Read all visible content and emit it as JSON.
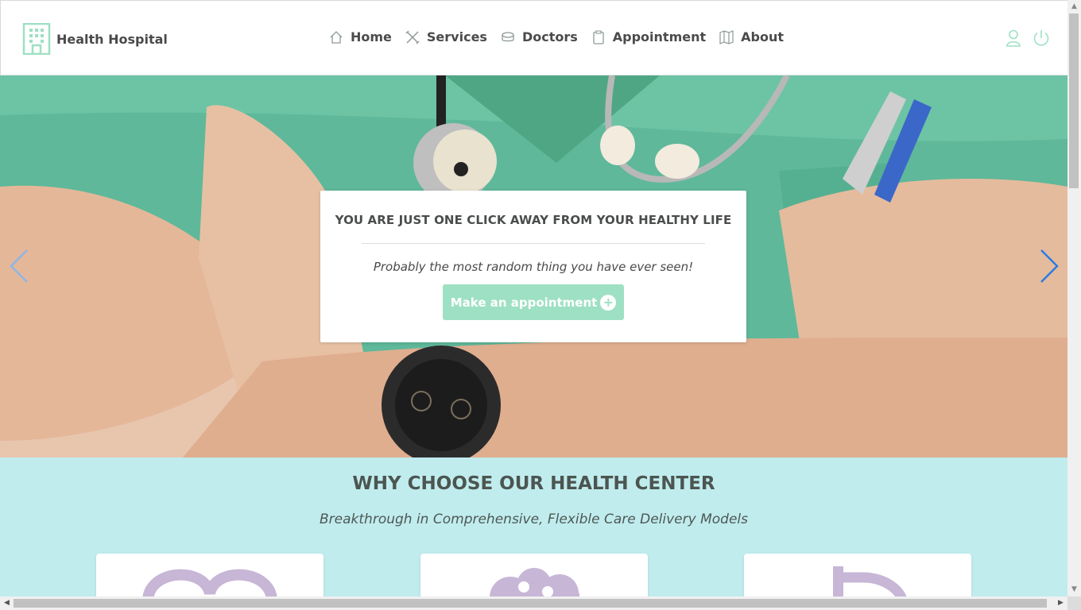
{
  "brand": {
    "name": "Health Hospital"
  },
  "nav": {
    "items": [
      {
        "label": "Home",
        "icon": "home-icon"
      },
      {
        "label": "Services",
        "icon": "tools-icon"
      },
      {
        "label": "Doctors",
        "icon": "doctors-icon"
      },
      {
        "label": "Appointment",
        "icon": "clipboard-icon"
      },
      {
        "label": "About",
        "icon": "map-icon"
      }
    ],
    "right_icons": [
      "user-icon",
      "power-icon"
    ]
  },
  "hero": {
    "title": "YOU ARE JUST ONE CLICK AWAY FROM YOUR HEALTHY LIFE",
    "subtitle": "Probably the most random thing you have ever seen!",
    "button_label": "Make an appointment",
    "button_icon": "plus-circle-icon",
    "prev_icon": "chevron-left-icon",
    "next_icon": "chevron-right-icon"
  },
  "why": {
    "title": "WHY CHOOSE OUR HEALTH CENTER",
    "subtitle": "Breakthrough in Comprehensive, Flexible Care Delivery Models",
    "cards": [
      {
        "icon": "infinity-icon"
      },
      {
        "icon": "cloud-icon"
      },
      {
        "icon": "dollar-icon"
      }
    ]
  },
  "colors": {
    "accent": "#9ee0c3",
    "section_bg": "#c0ecee",
    "card_icon": "#c7b6d6",
    "arrow_prev": "#8fb6e6",
    "arrow_next": "#2c7be5"
  }
}
